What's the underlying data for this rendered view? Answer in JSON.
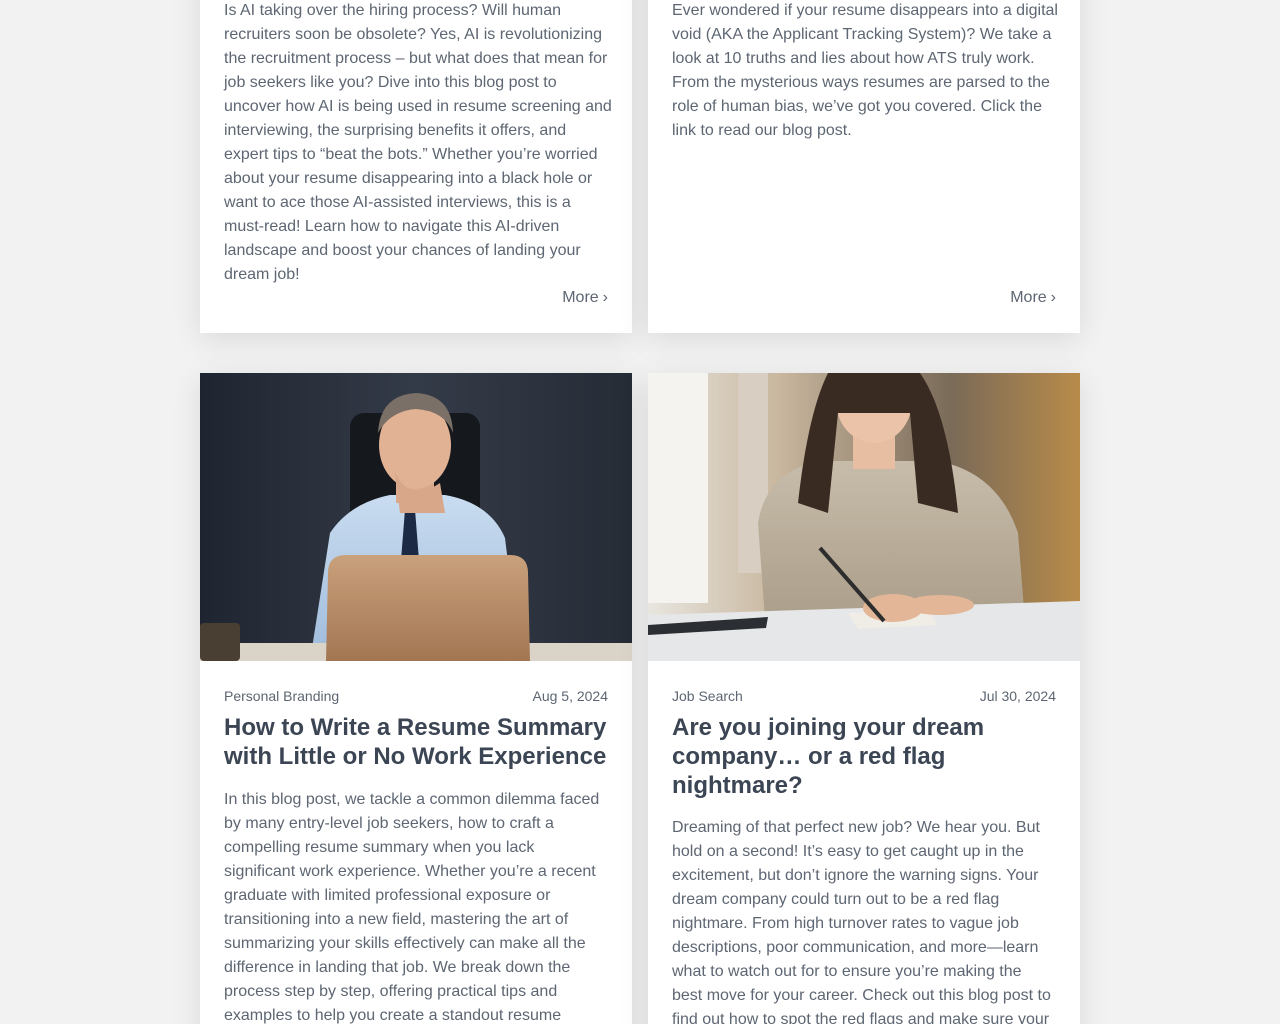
{
  "top_cards": [
    {
      "excerpt": "Is AI taking over the hiring process? Will human recruiters soon be obsolete? Yes, AI is revolutionizing the recruitment process – but what does that mean for job seekers like you? Dive into this blog post to uncover how AI is being used in resume screening and interviewing, the surprising benefits it offers, and expert tips to “beat the bots.” Whether you’re worried about your resume disappearing into a black hole or want to ace those AI-assisted interviews, this is a must-read! Learn how to navigate this AI-driven landscape and boost your chances of landing your dream job!",
      "more_label": "More",
      "more_chevron": "›"
    },
    {
      "excerpt": "Ever wondered if your resume disappears into a digital void (AKA the Applicant Tracking System)? We take a look at 10 truths and lies about how ATS truly work. From the mysterious ways resumes are parsed to the role of human bias, we’ve got you covered. Click the link to read our blog post.",
      "more_label": "More",
      "more_chevron": "›"
    }
  ],
  "bottom_cards": [
    {
      "image": "man-thinking-at-laptop",
      "category": "Personal Branding",
      "date": "Aug 5, 2024",
      "title": "How to Write a Resume Summary with Little or No Work Experience",
      "excerpt": "In this blog post, we tackle a common dilemma faced by many entry-level job seekers, how to craft a compelling resume summary when you lack significant work experience. Whether you’re a recent graduate with limited professional exposure or transitioning into a new field, mastering the art of summarizing your skills effectively can make all the difference in landing that job. We break down the process step by step, offering practical tips and examples to help you create a standout resume"
    },
    {
      "image": "woman-signing-document",
      "category": "Job Search",
      "date": "Jul 30, 2024",
      "title": "Are you joining your dream company… or a red flag nightmare?",
      "excerpt": "Dreaming of that perfect new job? We hear you. But hold on a second! It’s easy to get caught up in the excitement, but don’t ignore the warning signs. Your dream company could turn out to be a red flag nightmare. From high turnover rates to vague job descriptions, poor communication, and more—learn what to watch out for to ensure you’re making the best move for your career. Check out this blog post to find out how to spot the red flags and make sure your"
    }
  ],
  "colors": {
    "page_background": "#f2f2f2",
    "card_background": "#ffffff",
    "title_text": "#3b4553",
    "body_text": "#5d6672"
  }
}
